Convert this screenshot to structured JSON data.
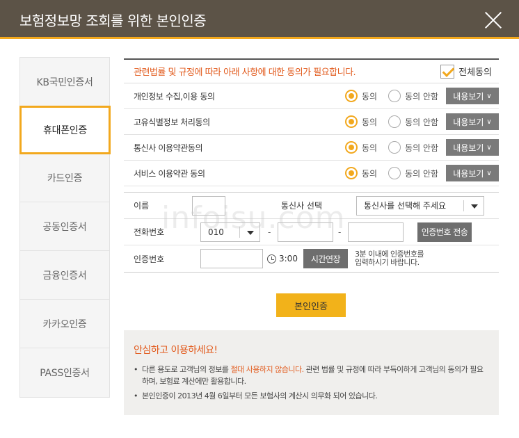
{
  "header": {
    "title": "보험정보망 조회를 위한 본인인증"
  },
  "sidebar": {
    "items": [
      {
        "label": "KB국민인증서"
      },
      {
        "label": "휴대폰인증"
      },
      {
        "label": "카드인증"
      },
      {
        "label": "공동인증서"
      },
      {
        "label": "금융인증서"
      },
      {
        "label": "카카오인증"
      },
      {
        "label": "PASS인증서"
      }
    ],
    "active_index": 1
  },
  "agreement": {
    "notice": "관련법률 및 규정에 따라 아래 사항에 대한 동의가 필요합니다.",
    "all_agree_label": "전체동의",
    "all_agree_checked": true,
    "rows": [
      {
        "label": "개인정보 수집,이용 동의",
        "agree": "동의",
        "disagree": "동의 안함",
        "view": "내용보기",
        "selected": "agree"
      },
      {
        "label": "고유식별정보 처리동의",
        "agree": "동의",
        "disagree": "동의 안함",
        "view": "내용보기",
        "selected": "agree"
      },
      {
        "label": "통신사 이용약관동의",
        "agree": "동의",
        "disagree": "동의 안함",
        "view": "내용보기",
        "selected": "agree"
      },
      {
        "label": "서비스 이용약관 동의",
        "agree": "동의",
        "disagree": "동의 안함",
        "view": "내용보기",
        "selected": "agree"
      }
    ]
  },
  "form": {
    "name_label": "이름",
    "name_value": "",
    "carrier_label": "통신사 선택",
    "carrier_value": "통신사를 선택해 주세요",
    "phone_label": "전화번호",
    "phone_prefix": "010",
    "phone_dash": "-",
    "send_code_label": "인증번호 전송",
    "code_label": "인증번호",
    "timer": "3:00",
    "extend_label": "시간연장",
    "hint_line1": "3분 이내에 인증번호를",
    "hint_line2": "입력하시기 바랍니다."
  },
  "submit_label": "본인인증",
  "notice": {
    "title": "안심하고 이용하세요!",
    "item1_before": "다른 용도로 고객님의 정보를 ",
    "item1_red": "절대 사용하지 않습니다.",
    "item1_after": " 관련 법률 및 규정에 따라 부득이하게 고객님의 동의가 필요하며, 보험료 계산에만 활용합니다.",
    "item2": "본인인증이 2013년 4월 6일부터 모든 보험사의 계산시 의무화 되어 있습니다."
  },
  "watermark": "infoisu.com",
  "colors": {
    "accent": "#f2a81d",
    "header_bg": "#5c5347",
    "notice_red": "#e25a1c"
  }
}
